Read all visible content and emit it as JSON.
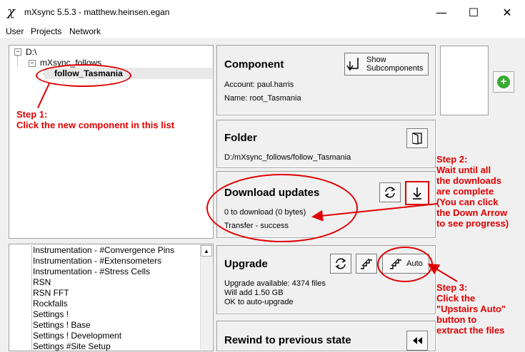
{
  "window": {
    "app_icon": "χ",
    "title": "mXsync 5.5.3 - matthew.heinsen.egan",
    "minimize_glyph": "—",
    "maximize_glyph": "☐",
    "close_glyph": "✕"
  },
  "menu": {
    "user": "User",
    "projects": "Projects",
    "network": "Network"
  },
  "tree": {
    "root": "D:\\",
    "folder": "mXsync_follows",
    "selected": "follow_Tasmania"
  },
  "list": {
    "items": [
      "Instrumentation - #Convergence Pins",
      "Instrumentation - #Extensometers",
      "Instrumentation - #Stress Cells",
      "RSN",
      "RSN FFT",
      "Rockfalls",
      "Settings !",
      "Settings ! Base",
      "Settings ! Development",
      "Settings #Site Setup"
    ]
  },
  "component": {
    "title": "Component",
    "show_btn_line1": "Show",
    "show_btn_line2": "Subcomponents",
    "account": "Account: paul.harris",
    "name": "Name: root_Tasmania"
  },
  "folder": {
    "title": "Folder",
    "path": "D:/mXsync_follows/follow_Tasmania"
  },
  "download": {
    "title": "Download updates",
    "status": "0 to download (0 bytes)",
    "transfer": "Transfer - success"
  },
  "upgrade": {
    "title": "Upgrade",
    "available": "Upgrade available: 4374 files",
    "will_add": "Will add 1.50 GB",
    "ok": "OK to auto-upgrade",
    "auto_label": "Auto"
  },
  "rewind": {
    "title": "Rewind to previous state"
  },
  "annotations": {
    "step1_a": "Step 1:",
    "step1_b": "Click the new component in this list",
    "step2": [
      "Step 2:",
      "Wait until all",
      "the downloads",
      "are complete",
      "(You can click",
      "the Down Arrow",
      "to see progress)"
    ],
    "step3": [
      "Step 3:",
      "Click the",
      "\"Upstairs Auto\"",
      "button to",
      "extract the files"
    ]
  },
  "colors": {
    "annotation": "#e00000",
    "add_button": "#3aaa35"
  }
}
